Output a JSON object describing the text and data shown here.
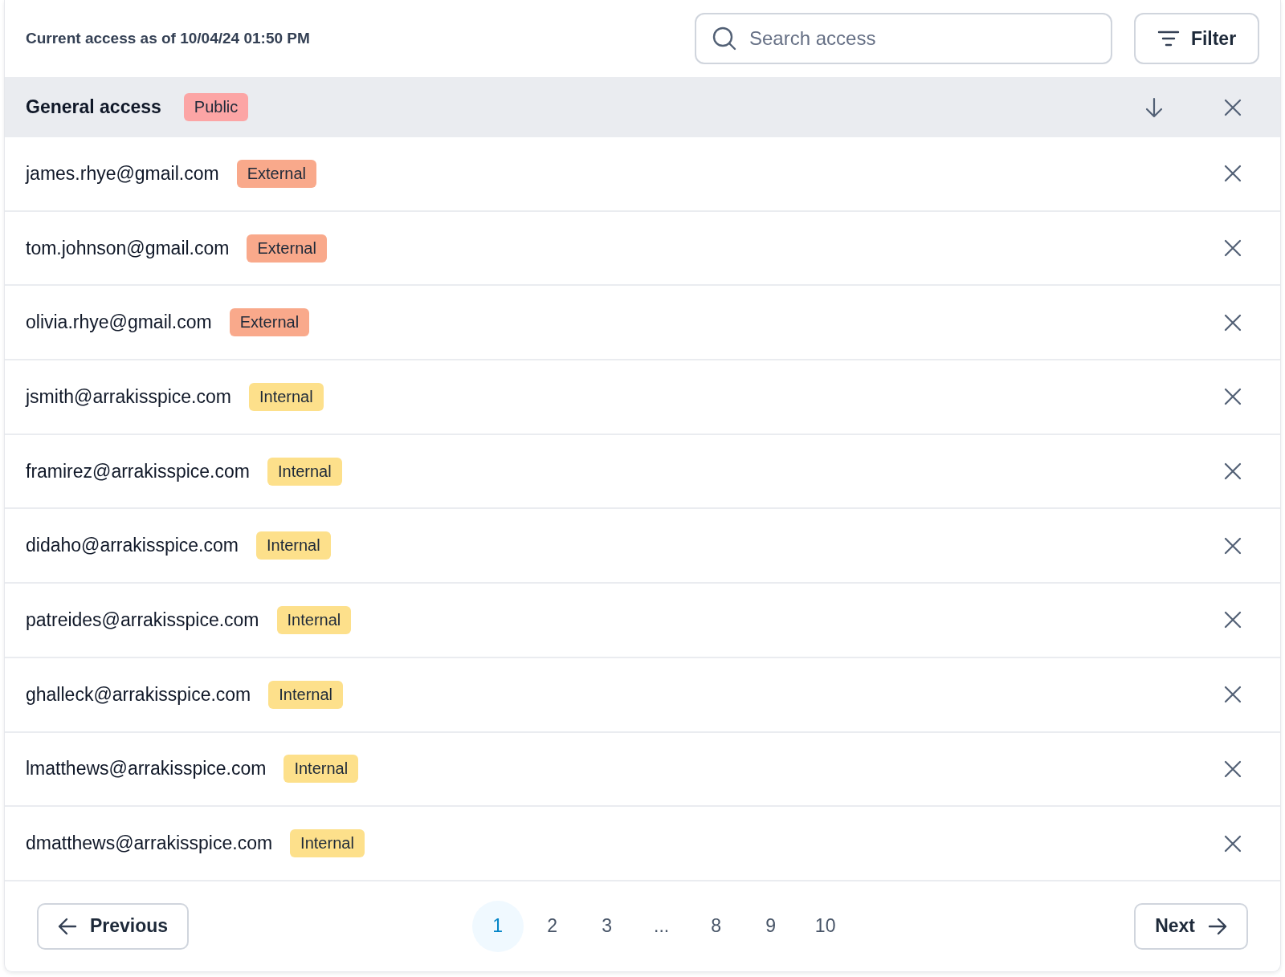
{
  "header": {
    "timestamp": "Current access as of 10/04/24 01:50 PM",
    "search": {
      "placeholder": "Search access"
    },
    "filter_button": "Filter"
  },
  "general_access": {
    "label": "General access",
    "badge": {
      "label": "Public",
      "kind": "public"
    }
  },
  "entries": [
    {
      "email": "james.rhye@gmail.com",
      "badge": {
        "label": "External",
        "kind": "external"
      }
    },
    {
      "email": "tom.johnson@gmail.com",
      "badge": {
        "label": "External",
        "kind": "external"
      }
    },
    {
      "email": "olivia.rhye@gmail.com",
      "badge": {
        "label": "External",
        "kind": "external"
      }
    },
    {
      "email": "jsmith@arrakisspice.com",
      "badge": {
        "label": "Internal",
        "kind": "internal"
      }
    },
    {
      "email": "framirez@arrakisspice.com",
      "badge": {
        "label": "Internal",
        "kind": "internal"
      }
    },
    {
      "email": "didaho@arrakisspice.com",
      "badge": {
        "label": "Internal",
        "kind": "internal"
      }
    },
    {
      "email": "patreides@arrakisspice.com",
      "badge": {
        "label": "Internal",
        "kind": "internal"
      }
    },
    {
      "email": "ghalleck@arrakisspice.com",
      "badge": {
        "label": "Internal",
        "kind": "internal"
      }
    },
    {
      "email": "lmatthews@arrakisspice.com",
      "badge": {
        "label": "Internal",
        "kind": "internal"
      }
    },
    {
      "email": "dmatthews@arrakisspice.com",
      "badge": {
        "label": "Internal",
        "kind": "internal"
      }
    }
  ],
  "pagination": {
    "previous": "Previous",
    "next": "Next",
    "pages": [
      {
        "label": "1",
        "selected": true
      },
      {
        "label": "2",
        "selected": false
      },
      {
        "label": "3",
        "selected": false
      },
      {
        "label": "...",
        "selected": false
      },
      {
        "label": "8",
        "selected": false
      },
      {
        "label": "9",
        "selected": false
      },
      {
        "label": "10",
        "selected": false
      }
    ]
  }
}
